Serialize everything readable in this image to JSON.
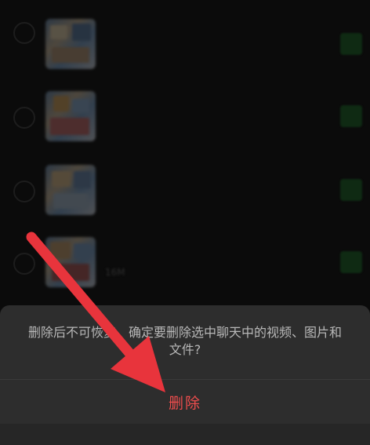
{
  "background_list": {
    "rows": [
      {
        "title": "",
        "size": ""
      },
      {
        "title": "",
        "size": ""
      },
      {
        "title": "",
        "size": ""
      },
      {
        "title": "",
        "size": "16M"
      }
    ]
  },
  "dialog": {
    "message": "删除后不可恢复，确定要删除选中聊天中的视频、图片和文件?",
    "delete_label": "删除"
  },
  "colors": {
    "sheet_background": "#2d2d2d",
    "delete_text": "#ee4d4d",
    "arrow": "#e8343c"
  },
  "annotation": {
    "icon": "red-arrow-icon"
  }
}
